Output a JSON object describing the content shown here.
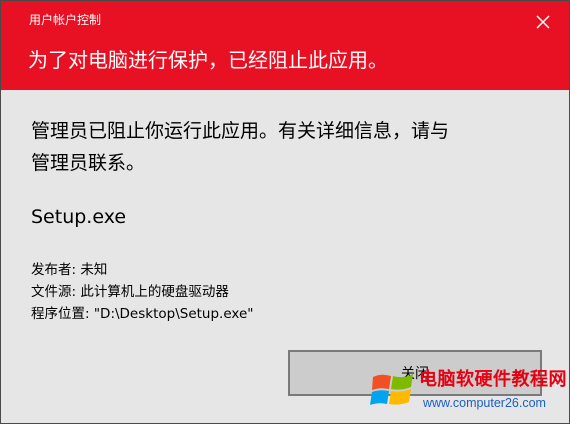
{
  "window": {
    "title": "用户帐户控制"
  },
  "header": {
    "headline": "为了对电脑进行保护，已经阻止此应用。"
  },
  "body": {
    "message": "管理员已阻止你运行此应用。有关详细信息，请与管理员联系。",
    "program_name": "Setup.exe",
    "details": [
      "发布者: 未知",
      "文件源: 此计算机上的硬盘驱动器",
      "程序位置: \"D:\\Desktop\\Setup.exe\""
    ]
  },
  "buttons": {
    "close_label": "关闭"
  },
  "watermark": {
    "brand": "电脑软硬件教程网",
    "url": "www.computer26.com"
  },
  "icons": {
    "close": "close-icon",
    "logo": "windows-logo-icon"
  },
  "colors": {
    "header_bg": "#e81123",
    "body_bg": "#e6e6e6",
    "button_bg": "#cccccc",
    "button_border": "#7a7a7a",
    "watermark_red": "#e60012",
    "watermark_blue": "#1a5fc4"
  }
}
